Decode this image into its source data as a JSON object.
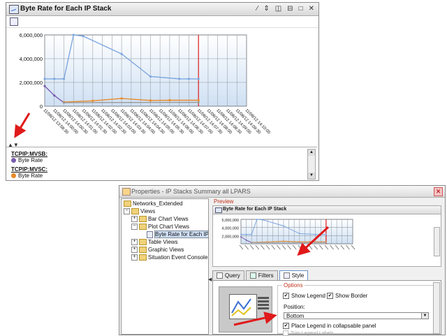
{
  "top_window": {
    "title": "Byte Rate for Each IP Stack",
    "controls": [
      "⁄",
      "⇕",
      "◫",
      "⊟",
      "□",
      "✕"
    ],
    "collapse_arrows": "▲▼",
    "legend": [
      {
        "name": "TCPIP:MVSB:",
        "series": "Byte Rate",
        "color": "#7a5cae"
      },
      {
        "name": "TCPIP:MVSC:",
        "series": "Byte Rate",
        "color": "#e88a2a"
      }
    ]
  },
  "chart_data": {
    "type": "line",
    "y_ticks": [
      "6,000,000",
      "4,000,000",
      "2,000,000",
      "0"
    ],
    "ylim": [
      0,
      6000000
    ],
    "x_tick_labels": [
      "11/06/12 13:58:30",
      "11/06/12 14:00:00",
      "11/06/12 14:00:30",
      "11/06/12 14:01:00",
      "11/06/12 14:01:30",
      "11/06/12 14:02:00",
      "11/06/12 14:02:30",
      "11/06/12 14:03:00",
      "11/06/12 14:03:30",
      "11/06/12 14:04:00",
      "11/06/12 14:04:30",
      "11/06/12 14:05:00",
      "11/06/12 14:05:30",
      "11/06/12 14:06:00",
      "11/06/12 14:06:30",
      "11/06/12 14:07:00",
      "11/06/12 14:07:30",
      "11/06/12 14:08:00",
      "11/06/12 14:08:30",
      "11/06/12 14:09:00",
      "11/06/12 14:09:30",
      "11/06/12 14:10:00"
    ],
    "x_count": 22,
    "grid": true,
    "marker_index": 16,
    "series": [
      {
        "color": "#7ea7df",
        "points": [
          [
            0,
            2300000
          ],
          [
            1,
            2300000
          ],
          [
            2,
            2300000
          ],
          [
            3,
            6000000
          ],
          [
            4,
            5900000
          ],
          [
            8,
            4400000
          ],
          [
            11,
            2500000
          ],
          [
            14,
            2300000
          ],
          [
            15,
            2300000
          ],
          [
            16,
            2300000
          ]
        ]
      },
      {
        "color": "#7a5cae",
        "points": [
          [
            0,
            1700000
          ],
          [
            1,
            900000
          ],
          [
            2,
            300000
          ]
        ]
      },
      {
        "color": "#e88a2a",
        "points": [
          [
            2,
            350000
          ],
          [
            5,
            450000
          ],
          [
            8,
            650000
          ],
          [
            11,
            480000
          ],
          [
            13,
            500000
          ],
          [
            16,
            500000
          ]
        ]
      },
      {
        "color": "#9a9a9a",
        "points": [
          [
            2,
            300000
          ],
          [
            16,
            320000
          ]
        ]
      }
    ]
  },
  "preview_chart": {
    "y_ticks": [
      "5,000,000",
      "4,000,000",
      "2,000,000"
    ]
  },
  "properties": {
    "title": "Properties - IP Stacks Summary all LPARS",
    "close": "✕",
    "tree": [
      {
        "label": "Networks_Extended",
        "level": 0,
        "kind": "folder"
      },
      {
        "label": "Views",
        "level": 0,
        "kind": "folder",
        "exp": "⊟"
      },
      {
        "label": "Bar Chart Views",
        "level": 1,
        "kind": "folder",
        "exp": "+"
      },
      {
        "label": "Plot Chart Views",
        "level": 1,
        "kind": "folder",
        "exp": "−"
      },
      {
        "label": "Byte Rate for Each IP Sta",
        "level": 2,
        "kind": "leaf",
        "selected": true
      },
      {
        "label": "Table Views",
        "level": 1,
        "kind": "folder",
        "exp": "+"
      },
      {
        "label": "Graphic Views",
        "level": 1,
        "kind": "folder",
        "exp": "+"
      },
      {
        "label": "Situation Event Console View",
        "level": 1,
        "kind": "folder",
        "exp": "+"
      }
    ],
    "splitter": "◀",
    "preview_label": "Preview",
    "preview_title": "Byte Rate for Each IP Stack",
    "tabs": [
      {
        "label": "Query",
        "active": false
      },
      {
        "label": "Filters",
        "active": false
      },
      {
        "label": "Style",
        "active": true
      }
    ],
    "options_label": "Options",
    "show_legend": "Show Legend",
    "show_border": "Show Border",
    "position_label": "Position:",
    "position_value": "Bottom",
    "place_legend": "Place Legend in collapsable panel",
    "trim_labels": "Trim Legend Labels",
    "check_mark": "✔"
  },
  "colors": {
    "arrow": "#e0191a",
    "marker_line": "#e0191a",
    "plot_bg_top": "#ffffff",
    "plot_bg_bottom": "#cfe0f3"
  }
}
